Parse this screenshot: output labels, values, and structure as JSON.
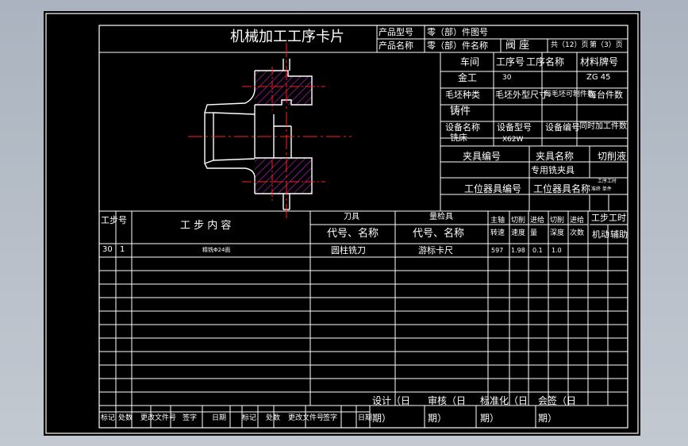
{
  "title": "机械加工工序卡片",
  "header": {
    "product_model_label": "产品型号",
    "product_name_label": "产品名称",
    "part_no_label": "零（部）件图号",
    "part_name_label": "零（部）件名称",
    "part_name_value": "阀  座",
    "total_pages": "共（12）页",
    "page_no": "第（3）页"
  },
  "info": {
    "workshop_label": "车间",
    "workshop_value": "金工",
    "op_no_label": "工序号",
    "op_no_value": "30",
    "op_name_label": "工序名称",
    "material_label": "材料牌号",
    "material_value": "ZG 45",
    "blank_type_label": "毛坯种类",
    "blank_type_value": "铸件",
    "blank_size_label": "毛坯外型尺寸",
    "blank_pieces_label": "每毛坯可制件数",
    "pieces_label": "每台件数",
    "equip_name_label": "设备名称",
    "equip_name_value": "铣床",
    "equip_model_label": "设备型号",
    "equip_model_value": "X62W",
    "equip_no_label": "设备编号",
    "simul_label": "同时加工件数",
    "fixture_no_label": "夹具编号",
    "fixture_name_label": "夹具名称",
    "coolant_label": "切削液",
    "fixture_name_value": "专用铣夹具",
    "station_tool_no_label": "工位器具编号",
    "station_tool_name_label": "工位器具名称",
    "time_label_1": "工序工时",
    "time_label_2": "准终 单件"
  },
  "table": {
    "col_step_no": "工步号",
    "col_step_content": "工 步 内 容",
    "col_tool_group": "刀具",
    "col_tool_sub": "代号、名称",
    "col_gauge_group": "量检具",
    "col_gauge_sub": "代号、名称",
    "col_spindle": "主轴转速",
    "col_cut_speed": "切削速度",
    "col_feed": "进给量",
    "col_depth": "切削深度",
    "col_passes": "进给次数",
    "col_hours_group": "工步工时",
    "col_machine": "机动",
    "col_aux": "辅助",
    "row": {
      "op": "30",
      "step": "1",
      "content": "精铣Φ24面",
      "tool": "圆柱铣刀",
      "gauge": "游标卡尺",
      "spindle": "597",
      "speed": "1.98",
      "feed": "0.1",
      "depth": "1.0"
    }
  },
  "signoff": {
    "design": "设计（日期）",
    "review": "审核（日期）",
    "standard": "标准化（日期）",
    "countersign": "会签（日期）"
  },
  "revision_labels": [
    "标记",
    "处数",
    "更改文件号",
    "签字",
    "日期",
    "标记",
    "处数",
    "更改文件号",
    "签字",
    "日期"
  ],
  "colors": {
    "background": "#000000",
    "frame": "#ffffff",
    "part_outline": "#ffffff",
    "centerline": "#ff2020",
    "hatch": "#cc22cc",
    "page": "#b8c0ca"
  }
}
